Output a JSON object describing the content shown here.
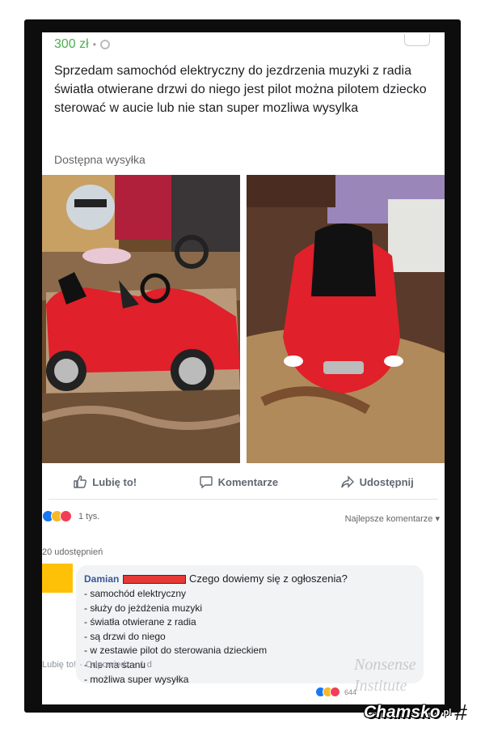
{
  "listing": {
    "price": "300 zł",
    "separator": "•",
    "description": "Sprzedam samochód elektryczny do jezdrzenia muzyki z radia światła otwierane drzwi do niego jest pilot można pilotem dziecko sterować w aucie  lub nie stan  super mozliwa wysylka",
    "shipping": "Dostępna wysyłka"
  },
  "photos": [
    "red ride-on toy car, side view",
    "red ride-on toy car, front view"
  ],
  "actions": {
    "like": "Lubię to!",
    "comment": "Komentarze",
    "share": "Udostępnij"
  },
  "reactions": {
    "count": "1 tys.",
    "sort": "Najlepsze komentarze ▾",
    "shares": "20 udostępnień"
  },
  "comment": {
    "author": "Damian",
    "question": "Czego dowiemy się z ogłoszenia?",
    "lines": [
      "- samochód elektryczny",
      "- służy do jeżdżenia muzyki",
      "- światła otwierane z radia",
      "- są drzwi do niego",
      "- w zestawie pilot do sterowania dzieckiem",
      "- nie ma stanu",
      "- możliwa super wysyłka"
    ],
    "like": "Lubię to!",
    "reply": "Odpowiedz",
    "time": "1 d",
    "reaction_count": "644"
  },
  "watermark": {
    "line1": "Nonsense",
    "line2": "Institute"
  },
  "brand": {
    "name": "Chamsko",
    "tld": ".pl"
  },
  "icons": {
    "location": "map-pin-icon",
    "like": "thumbs-up-icon",
    "comment": "speech-bubble-icon",
    "share": "share-arrow-icon",
    "brand": "hash-icon"
  },
  "colors": {
    "price": "#4caf50",
    "link": "#385898",
    "redaction": "#e53935",
    "avatar": "#ffc107"
  }
}
